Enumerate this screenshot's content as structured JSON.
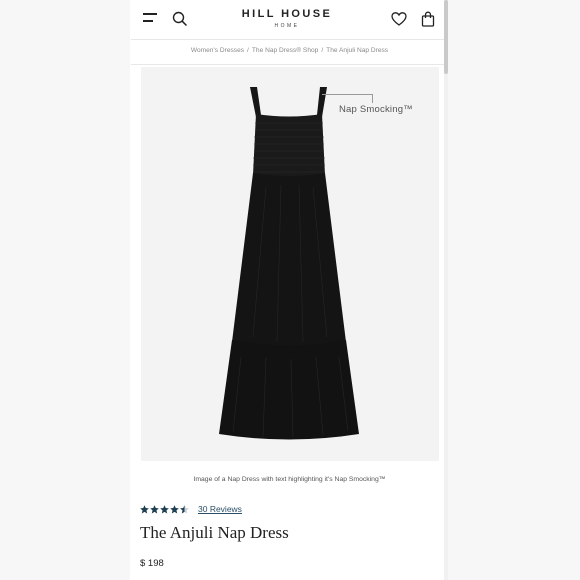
{
  "header": {
    "logo_main": "HILL HOUSE",
    "logo_sub": "HOME",
    "icons": [
      "menu-icon",
      "search-icon",
      "heart-icon",
      "shopping-bag-icon"
    ]
  },
  "breadcrumb": {
    "items": [
      "Women's Dresses",
      "The Nap Dress® Shop",
      "The Anjuli Nap Dress"
    ],
    "separator": "/"
  },
  "product": {
    "callout": "Nap Smocking™",
    "image_caption": "Image of a Nap Dress with text highlighting it's Nap Smocking™",
    "rating": 4.5,
    "reviews_label": "30 Reviews",
    "title": "The Anjuli Nap Dress",
    "price": "$ 198"
  },
  "colors": {
    "dress": "#141414",
    "image_background": "#f3f3f3",
    "star": "#1f4052",
    "link": "#2a4f66"
  }
}
